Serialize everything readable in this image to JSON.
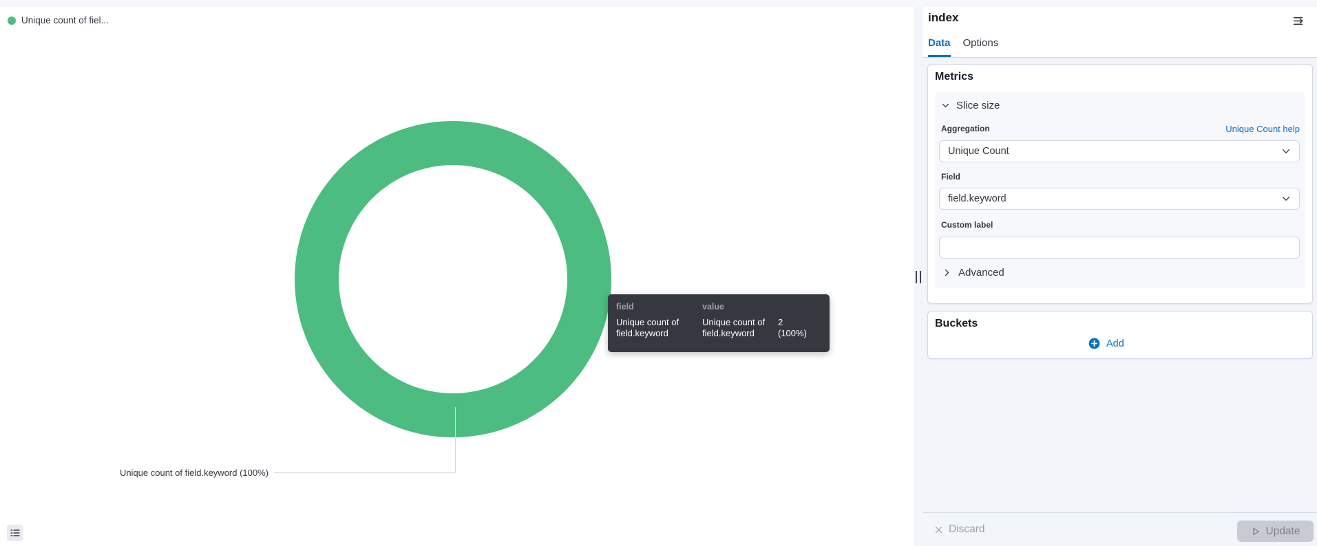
{
  "colors": {
    "slice_green": "#4cbc80",
    "link_blue": "#0b6fc1",
    "text_dark": "#343741",
    "tooltip_bg": "#36383f"
  },
  "chart": {
    "legend": {
      "label": "Unique count of fiel..."
    },
    "slice_callout_label": "Unique count of field.keyword (100%)",
    "tooltip": {
      "col_field": "field",
      "col_value": "value",
      "row_field": "Unique count of field.keyword",
      "row_value": "Unique count of field.keyword",
      "row_number": "2",
      "row_pct": "(100%)"
    }
  },
  "chart_data": {
    "type": "pie",
    "donut": true,
    "categories": [
      "Unique count of field.keyword"
    ],
    "values": [
      2
    ],
    "percentages": [
      100
    ],
    "series_color": "#4cbc80",
    "legend_position": "top-left",
    "title": ""
  },
  "panel": {
    "title": "index",
    "tabs": [
      {
        "label": "Data",
        "active": true
      },
      {
        "label": "Options",
        "active": false
      }
    ],
    "metrics": {
      "heading": "Metrics",
      "accordion_label": "Slice size",
      "aggregation_label": "Aggregation",
      "help_link": "Unique Count help",
      "aggregation_value": "Unique Count",
      "field_label": "Field",
      "field_value": "field.keyword",
      "custom_label_label": "Custom label",
      "custom_label_value": "",
      "advanced_label": "Advanced"
    },
    "buckets": {
      "heading": "Buckets",
      "add_label": "Add"
    },
    "footer": {
      "discard_label": "Discard",
      "update_label": "Update"
    }
  }
}
